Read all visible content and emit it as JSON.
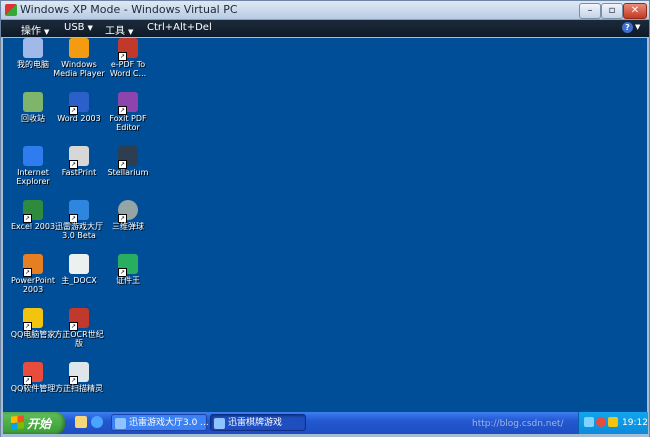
{
  "window": {
    "title": "Windows XP Mode - Windows Virtual PC"
  },
  "menubar": {
    "items": [
      "操作",
      "USB",
      "工具",
      "Ctrl+Alt+Del"
    ],
    "help": "?"
  },
  "desktop": {
    "icons": [
      {
        "label": "我的电脑",
        "icon": "my-computer-icon",
        "color": "#9fb9e8"
      },
      {
        "label": "Windows\nMedia Player",
        "icon": "media-player-icon",
        "color": "#f39c12"
      },
      {
        "label": "e-PDF To\nWord C...",
        "icon": "pdf-to-word-icon",
        "color": "#c0392b"
      },
      {
        "label": "回收站",
        "icon": "recycle-bin-icon",
        "color": "#7fb56b"
      },
      {
        "label": "Word 2003",
        "icon": "word-icon",
        "color": "#2b5fc9"
      },
      {
        "label": "Foxit PDF\nEditor",
        "icon": "foxit-pdf-icon",
        "color": "#8e44ad"
      },
      {
        "label": "Internet\nExplorer",
        "icon": "internet-explorer-icon",
        "color": "#2f7cf0"
      },
      {
        "label": "FastPrint",
        "icon": "fastprint-icon",
        "color": "#d7d7d7"
      },
      {
        "label": "Stellarium",
        "icon": "stellarium-icon",
        "color": "#2c3e50"
      },
      {
        "label": "Excel 2003",
        "icon": "excel-icon",
        "color": "#2e8b3e"
      },
      {
        "label": "迅雷游戏大厅\n3.0 Beta",
        "icon": "xunlei-game-icon",
        "color": "#2e86de"
      },
      {
        "label": "三维弹球",
        "icon": "pinball-icon",
        "color": "#95a5a6"
      },
      {
        "label": "PowerPoint\n2003",
        "icon": "powerpoint-icon",
        "color": "#e67e22"
      },
      {
        "label": "主_DOCX",
        "icon": "docx-file-icon",
        "color": "#ecf0f1"
      },
      {
        "label": "证件王",
        "icon": "zhengjianwang-icon",
        "color": "#27ae60"
      },
      {
        "label": "QQ电脑管家",
        "icon": "qq-manager-icon",
        "color": "#f1c40f"
      },
      {
        "label": "方正OCR世纪\n版",
        "icon": "founder-ocr-icon",
        "color": "#c0392b"
      },
      {
        "label": "QQ软件管理",
        "icon": "qq-software-icon",
        "color": "#e74c3c"
      },
      {
        "label": "方正扫描精灵",
        "icon": "founder-scan-icon",
        "color": "#dfe6e9"
      }
    ]
  },
  "taskbar": {
    "start_label": "开始",
    "tasks": [
      "迅雷游戏大厅3.0 ...",
      "迅雷棋牌游戏"
    ],
    "clock": "19:12"
  },
  "watermark": "http://blog.csdn.net/"
}
